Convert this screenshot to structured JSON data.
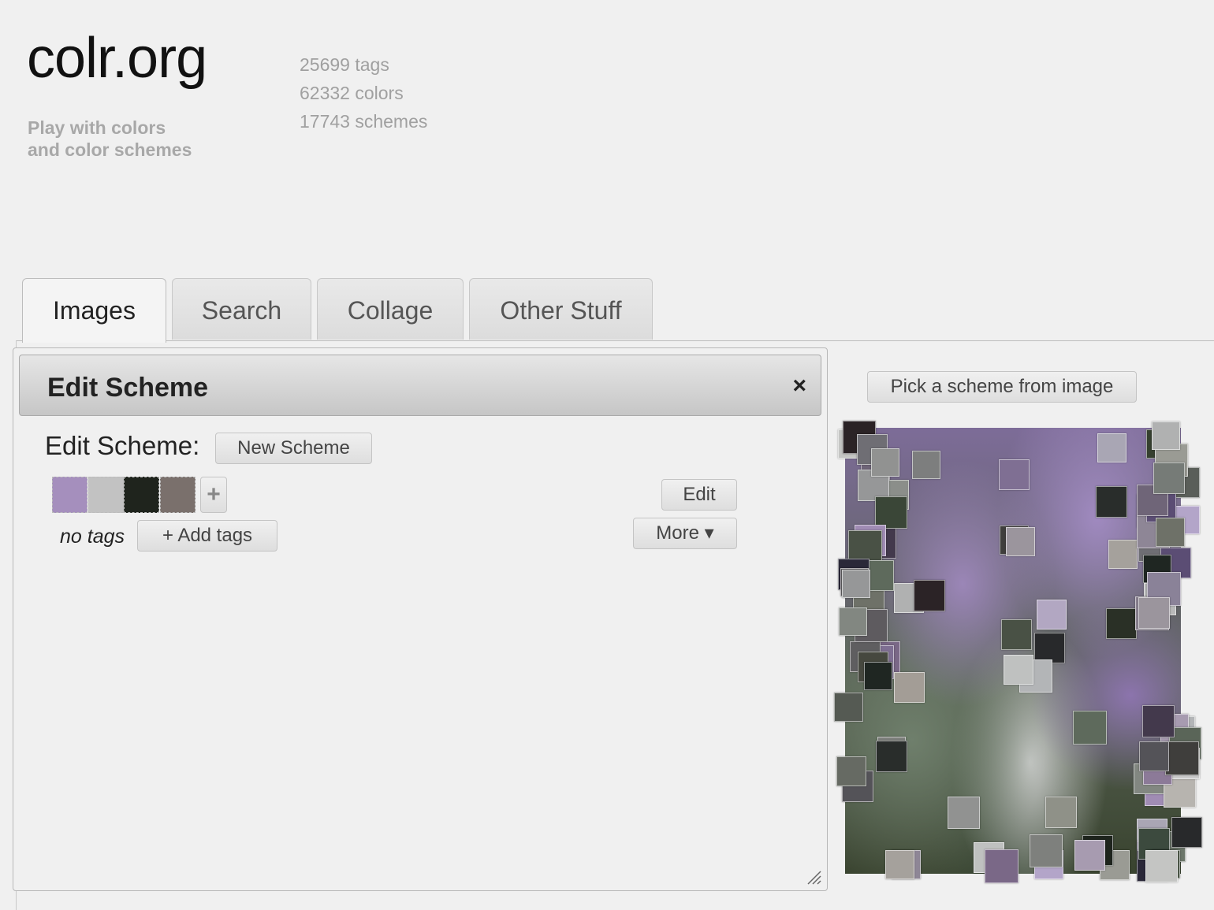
{
  "header": {
    "logo": "colr.org",
    "tagline_1": "Play with colors",
    "tagline_2": "and color schemes",
    "stats": [
      "25699 tags",
      "62332 colors",
      "17743 schemes"
    ]
  },
  "tabs": [
    {
      "label": "Images",
      "active": true
    },
    {
      "label": "Search",
      "active": false
    },
    {
      "label": "Collage",
      "active": false
    },
    {
      "label": "Other Stuff",
      "active": false
    }
  ],
  "dialog": {
    "title": "Edit Scheme",
    "close_icon": "×",
    "edit_label": "Edit Scheme:",
    "new_scheme_button": "New Scheme",
    "swatches": [
      "#a58fbd",
      "#c2c2c2",
      "#1f241d",
      "#7a706c"
    ],
    "add_color_button": "+",
    "edit_button": "Edit",
    "more_button": "More ▾",
    "no_tags": "no tags",
    "add_tags_button": "+ Add tags"
  },
  "image_panel": {
    "pick_button": "Pick a scheme from image",
    "colors": [
      "#6f6e74",
      "#a9a6b4",
      "#a08cb4",
      "#43394c",
      "#7a6887",
      "#8e8696",
      "#b3a5c9",
      "#5b4d74",
      "#3f3e3c",
      "#545358",
      "#8a8298",
      "#9b959d",
      "#b3b5b7",
      "#6f6578",
      "#a79bb0",
      "#7f6f93",
      "#495145",
      "#8b8e8a",
      "#9a9b94",
      "#5e6a5c",
      "#6e7168",
      "#767b77",
      "#b0b1b1",
      "#2a2838",
      "#28292b",
      "#a5a19c",
      "#7e807d",
      "#919291",
      "#c4c5c3",
      "#292d2b",
      "#5f5e60",
      "#1f2622",
      "#2b2326",
      "#969798",
      "#828781",
      "#bfc1c0",
      "#b8b9b9",
      "#7d7e7e",
      "#555a53",
      "#6c766a",
      "#3c4a3e",
      "#5a6558",
      "#2a3026",
      "#1e241d",
      "#8f9188",
      "#a39d96",
      "#b7b4af",
      "#cbcbcb",
      "#4f5a4b",
      "#3a4637",
      "#36402f",
      "#8a8390",
      "#8c7a98",
      "#b2a7c2",
      "#5e5b5f",
      "#4d4a47",
      "#46483f",
      "#666a63",
      "#5a5e59"
    ]
  }
}
